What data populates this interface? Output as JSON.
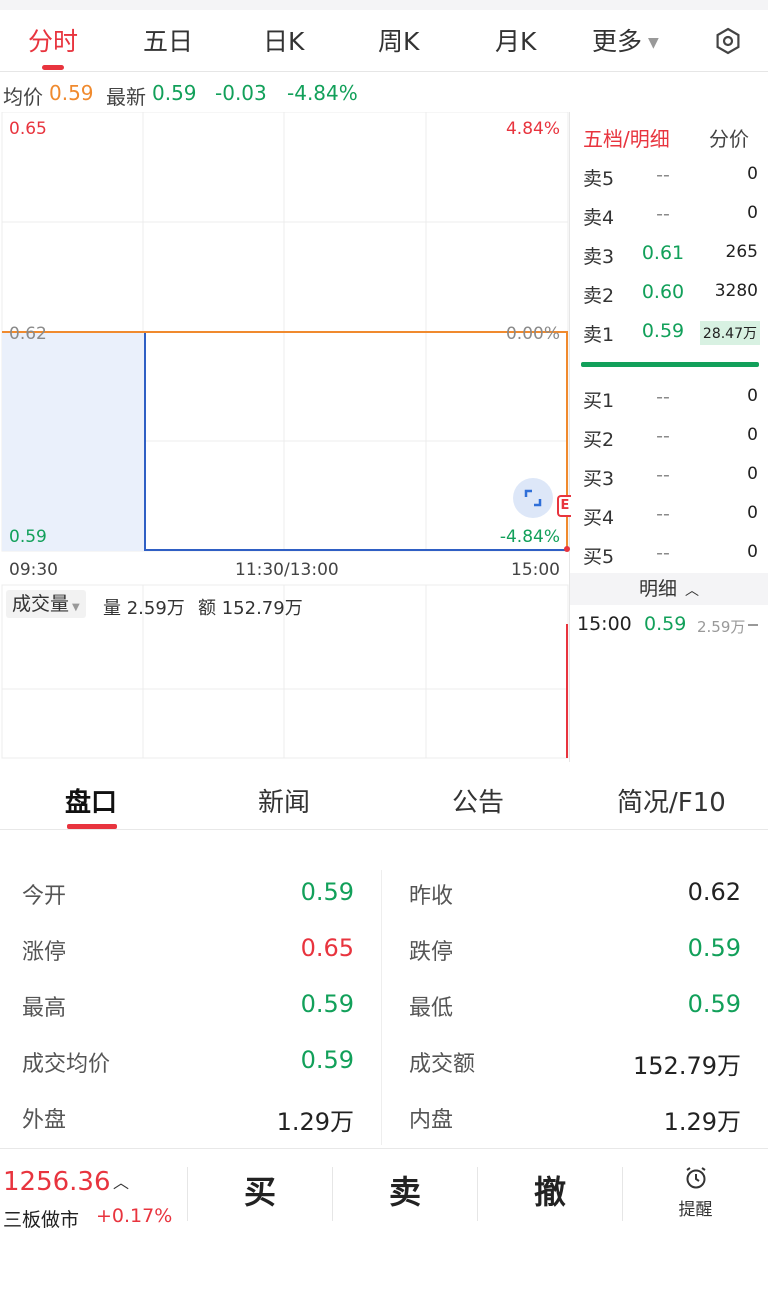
{
  "top_tabs": [
    "分时",
    "五日",
    "日K",
    "周K",
    "月K",
    "更多"
  ],
  "info": {
    "avg_label": "均价",
    "avg_value": "0.59",
    "latest_label": "最新",
    "latest_value": "0.59",
    "change": "-0.03",
    "change_pct": "-4.84%"
  },
  "chart": {
    "y_high": "0.65",
    "y_mid": "0.62",
    "y_low": "0.59",
    "pct_high": "4.84%",
    "pct_mid": "0.00%",
    "pct_low": "-4.84%",
    "time_start": "09:30",
    "time_mid": "11:30/13:00",
    "time_end": "15:00",
    "volume_label": "成交量",
    "vol_text": "量 2.59万",
    "amt_text": "额 152.79万",
    "side_badge": "E"
  },
  "order_book": {
    "title": "五档/明细",
    "alt_title": "分价",
    "sells": [
      {
        "label": "卖5",
        "price": "--",
        "vol": "0"
      },
      {
        "label": "卖4",
        "price": "--",
        "vol": "0"
      },
      {
        "label": "卖3",
        "price": "0.61",
        "vol": "265"
      },
      {
        "label": "卖2",
        "price": "0.60",
        "vol": "3280"
      },
      {
        "label": "卖1",
        "price": "0.59",
        "vol": "28.47万"
      }
    ],
    "buys": [
      {
        "label": "买1",
        "price": "--",
        "vol": "0"
      },
      {
        "label": "买2",
        "price": "--",
        "vol": "0"
      },
      {
        "label": "买3",
        "price": "--",
        "vol": "0"
      },
      {
        "label": "买4",
        "price": "--",
        "vol": "0"
      },
      {
        "label": "买5",
        "price": "--",
        "vol": "0"
      }
    ],
    "detail_label": "明细",
    "detail_row": {
      "time": "15:00",
      "price": "0.59",
      "vol": "2.59万"
    }
  },
  "bottom_tabs": [
    "盘口",
    "新闻",
    "公告",
    "简况/F10"
  ],
  "stats": [
    {
      "l1": "今开",
      "v1": "0.59",
      "l2": "昨收",
      "v2": "0.62"
    },
    {
      "l1": "涨停",
      "v1": "0.65",
      "l2": "跌停",
      "v2": "0.59"
    },
    {
      "l1": "最高",
      "v1": "0.59",
      "l2": "最低",
      "v2": "0.59"
    },
    {
      "l1": "成交均价",
      "v1": "0.59",
      "l2": "成交额",
      "v2": "152.79万"
    },
    {
      "l1": "外盘",
      "v1": "1.29万",
      "l2": "内盘",
      "v2": "1.29万"
    }
  ],
  "footer": {
    "index_value": "1256.36",
    "index_name": "三板做市",
    "index_change": "+0.17%",
    "buy": "买",
    "sell": "卖",
    "cancel": "撤",
    "alert": "提醒"
  },
  "colors": {
    "up": "#e8343e",
    "down": "#12a05a",
    "avg": "#f08a2e",
    "price_line": "#2f5fc4"
  }
}
